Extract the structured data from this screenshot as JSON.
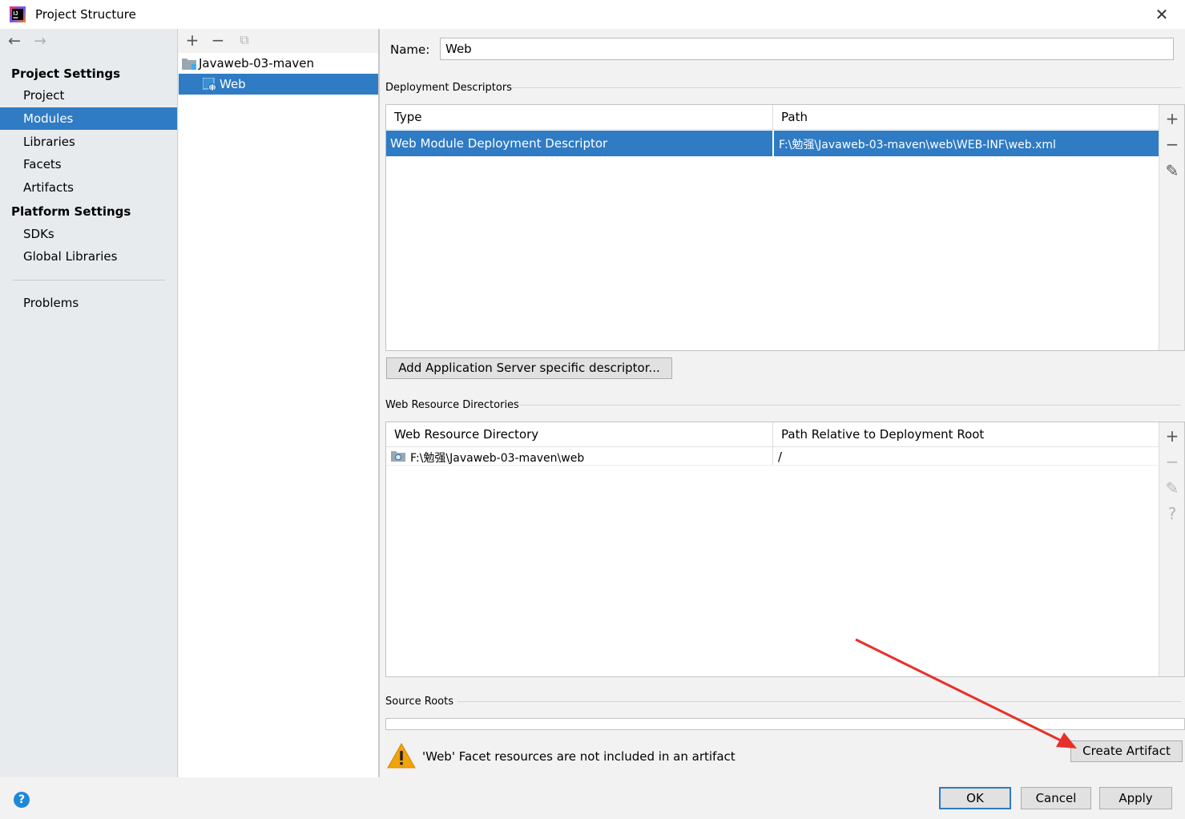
{
  "window": {
    "title": "Project Structure",
    "close_symbol": "✕"
  },
  "sidebar": {
    "back_symbol": "←",
    "forward_symbol": "→",
    "project_settings_heading": "Project Settings",
    "project_items": [
      "Project",
      "Modules",
      "Libraries",
      "Facets",
      "Artifacts"
    ],
    "platform_settings_heading": "Platform Settings",
    "platform_items": [
      "SDKs",
      "Global Libraries"
    ],
    "problems": "Problems",
    "selected": "Modules"
  },
  "tree": {
    "toolbar": {
      "add": "+",
      "remove": "−",
      "copy": "⧉"
    },
    "nodes": [
      {
        "label": "Javaweb-03-maven",
        "icon": "module-folder-icon"
      },
      {
        "label": "Web",
        "icon": "web-facet-icon"
      }
    ]
  },
  "content": {
    "name_label": "Name:",
    "name_value": "Web",
    "deployment": {
      "heading": "Deployment Descriptors",
      "columns": [
        "Type",
        "Path"
      ],
      "rows": [
        {
          "type": "Web Module Deployment Descriptor",
          "path": "F:\\勉强\\Javaweb-03-maven\\web\\WEB-INF\\web.xml"
        }
      ],
      "tools": {
        "add": "+",
        "remove": "−",
        "edit": "✎"
      },
      "add_server_button": "Add Application Server specific descriptor..."
    },
    "web_resources": {
      "heading": "Web Resource Directories",
      "columns": [
        "Web Resource Directory",
        "Path Relative to Deployment Root"
      ],
      "rows": [
        {
          "directory": "F:\\勉强\\Javaweb-03-maven\\web",
          "relative": "/"
        }
      ],
      "tools": {
        "add": "+",
        "remove": "−",
        "edit": "✎",
        "help": "?"
      }
    },
    "source_roots": {
      "heading": "Source Roots"
    },
    "warning": {
      "text": "'Web' Facet resources are not included in an artifact",
      "action": "Create Artifact"
    }
  },
  "footer": {
    "help": "?",
    "ok": "OK",
    "cancel": "Cancel",
    "apply": "Apply"
  },
  "colors": {
    "selection": "#2f7bc4",
    "warning": "#f0a30a",
    "arrow": "#e8302a",
    "help": "#1e88d8"
  }
}
